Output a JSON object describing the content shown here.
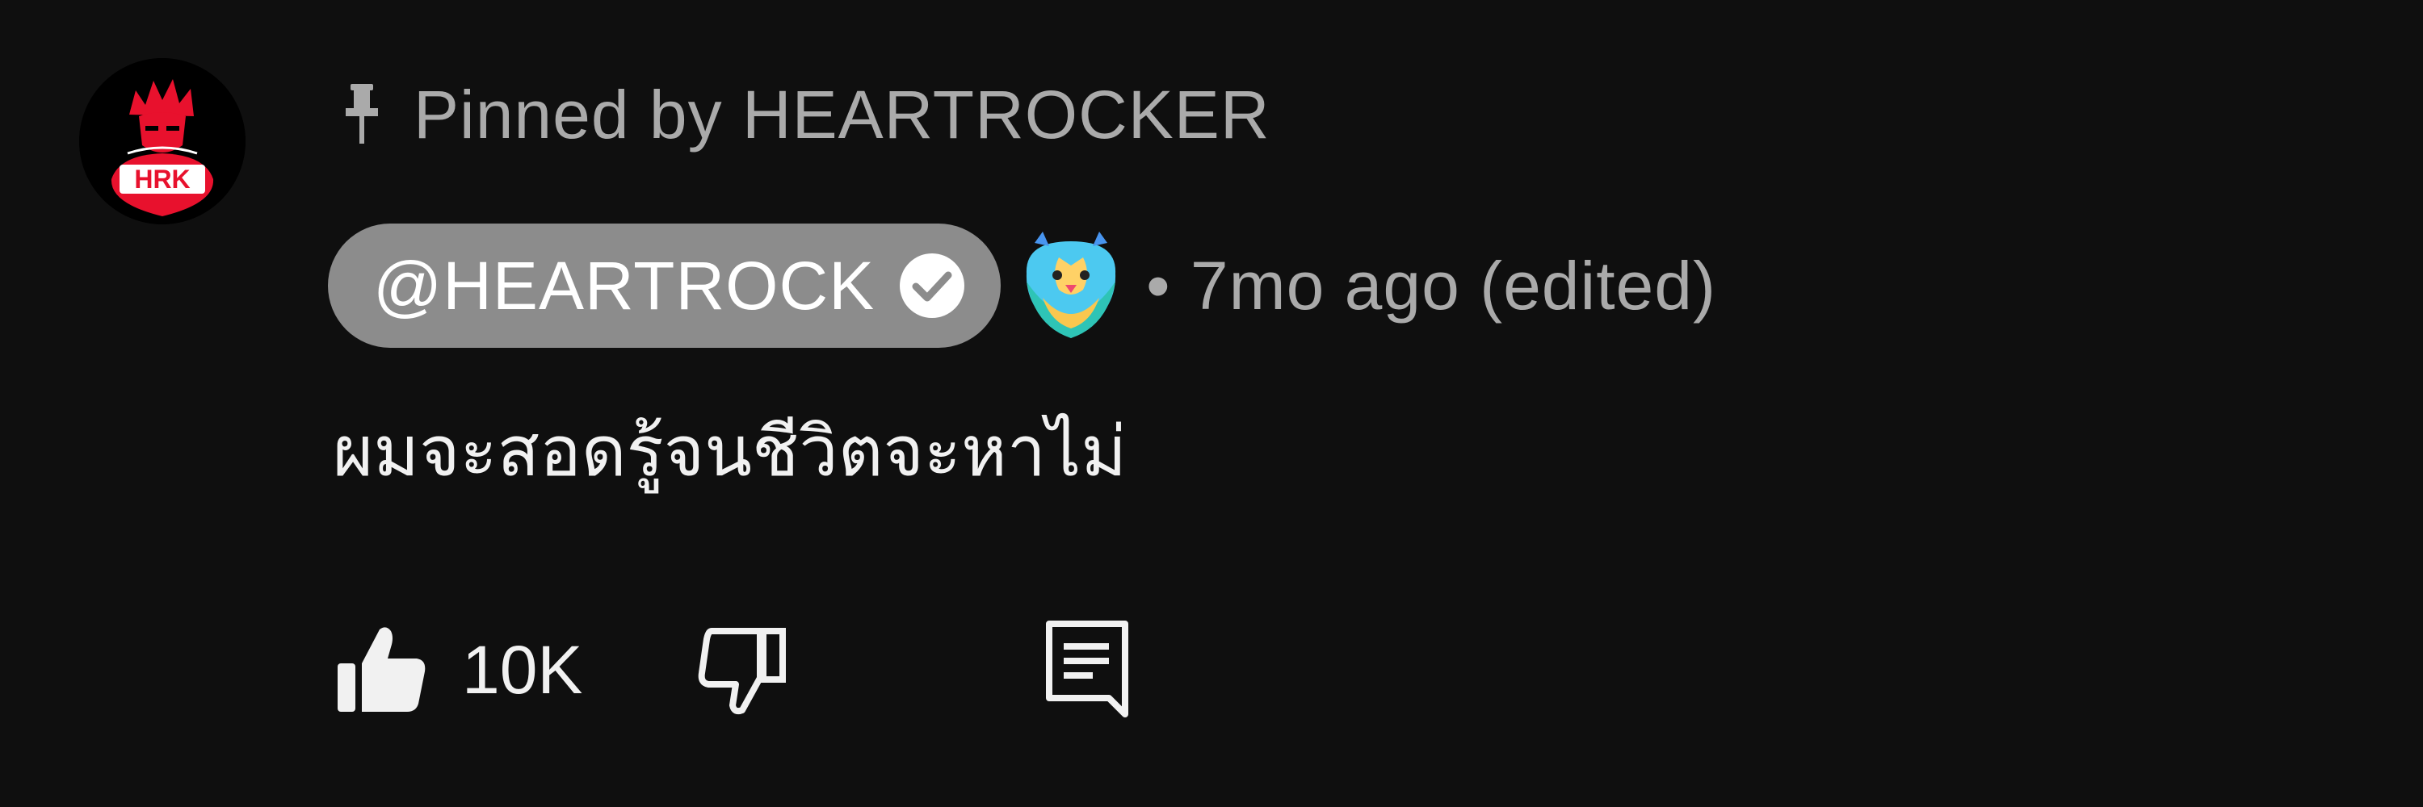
{
  "avatar": {
    "label": "HRK",
    "icon": "hrk-avatar-logo",
    "accent": "#e8112d"
  },
  "pinned": {
    "icon": "pin-icon",
    "text": "Pinned by HEARTROCKER"
  },
  "author": {
    "handle": "@HEARTROCK",
    "verified_icon": "verified-check-icon",
    "badge_icon": "member-badge-icon",
    "chip_color": "#8c8c8c"
  },
  "meta": {
    "time": "• 7mo ago (edited)"
  },
  "comment": {
    "text": "ผมจะสอดรู้จนชีวิตจะหาไม่"
  },
  "actions": {
    "like_icon": "thumb-up-icon",
    "like_count": "10K",
    "dislike_icon": "thumb-down-icon",
    "reply_icon": "reply-icon"
  }
}
